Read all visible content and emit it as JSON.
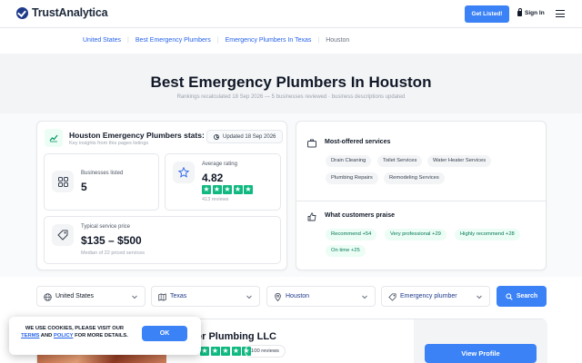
{
  "header": {
    "logo_text": "TrustAnalytica",
    "get_listed_label": "Get Listed!",
    "sign_in_label": "Sign In"
  },
  "breadcrumb": {
    "items": [
      "United States",
      "Best Emergency Plumbers",
      "Emergency Plumbers In Texas"
    ],
    "current": "Houston"
  },
  "hero": {
    "title": "Best Emergency Plumbers In Houston",
    "subtitle": "Rankings recalculated 18 Sep 2026 — 5 businesses reviewed · business descriptions updated"
  },
  "stats": {
    "title": "Houston Emergency Plumbers stats:",
    "subtitle": "Key insights from this pages listings",
    "updated": "Updated 18 Sep 2026",
    "businesses_label": "Businesses listed",
    "businesses_value": "5",
    "rating_label": "Average rating",
    "rating_value": "4.82",
    "rating_reviews": "413 reviews",
    "rating_stars": 4.82,
    "price_label": "Typical service price",
    "price_value": "$135 – $500",
    "price_note": "Median of 22 priced services"
  },
  "offered": {
    "title": "Most-offered services",
    "services": [
      "Drain Cleaning",
      "Toilet Services",
      "Water Heater Services",
      "Plumbing Repairs",
      "Remodeling Services"
    ]
  },
  "praise": {
    "title": "What customers praise",
    "items": [
      "Recommend +54",
      "Very professional +29",
      "Highly recommend +28",
      "On time +25"
    ]
  },
  "filters": {
    "country": "United States",
    "state": "Texas",
    "city": "Houston",
    "category": "Emergency plumber",
    "search_label": "Search"
  },
  "listing": {
    "title": "er Plumbing LLC",
    "reviews": "100 reviews",
    "view_label": "View Profile"
  },
  "cookie": {
    "text_before": "We use cookies, please visit our ",
    "terms": "terms",
    "and": " and ",
    "policy": "policy",
    "text_after": " for more details.",
    "ok_label": "OK"
  },
  "colors": {
    "accent": "#3b82f6",
    "star": "#10b981",
    "link": "#2563eb"
  }
}
